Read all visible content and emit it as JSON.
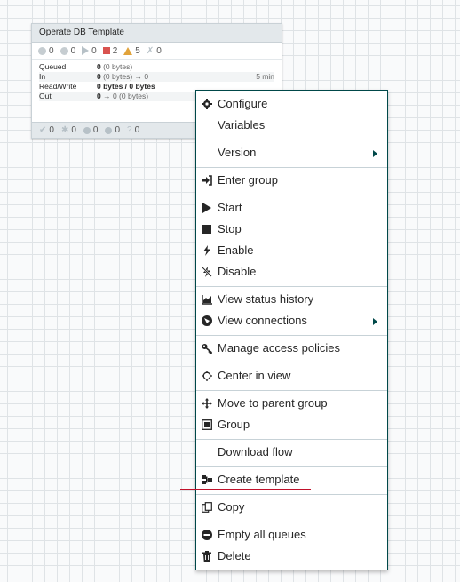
{
  "process_group": {
    "title": "Operate DB Template",
    "status_counts": [
      "0",
      "0",
      "0",
      "2",
      "5",
      "0"
    ],
    "stats": [
      {
        "label": "Queued",
        "value_bold": "0",
        "value_rest": " (0 bytes)",
        "time": ""
      },
      {
        "label": "In",
        "value_bold": "0",
        "value_rest": " (0 bytes) → 0",
        "time": "5 min"
      },
      {
        "label": "Read/Write",
        "value_bold": "0 bytes / 0 bytes",
        "value_rest": "",
        "time": ""
      },
      {
        "label": "Out",
        "value_bold": "0",
        "value_rest": " → 0 (0 bytes)",
        "time": ""
      }
    ],
    "footer_counts": [
      "0",
      "0",
      "0",
      "0",
      "0"
    ]
  },
  "menu": {
    "configure": "Configure",
    "variables": "Variables",
    "version": "Version",
    "enter_group": "Enter group",
    "start": "Start",
    "stop": "Stop",
    "enable": "Enable",
    "disable": "Disable",
    "view_status_history": "View status history",
    "view_connections": "View connections",
    "manage_access_policies": "Manage access policies",
    "center_in_view": "Center in view",
    "move_to_parent_group": "Move to parent group",
    "group": "Group",
    "download_flow": "Download flow",
    "create_template": "Create template",
    "copy": "Copy",
    "empty_all_queues": "Empty all queues",
    "delete": "Delete"
  },
  "colors": {
    "menu_border": "#004849",
    "stopped": "#d9534f",
    "warning": "#e1a33b",
    "annotation_underline": "#c0102a"
  }
}
